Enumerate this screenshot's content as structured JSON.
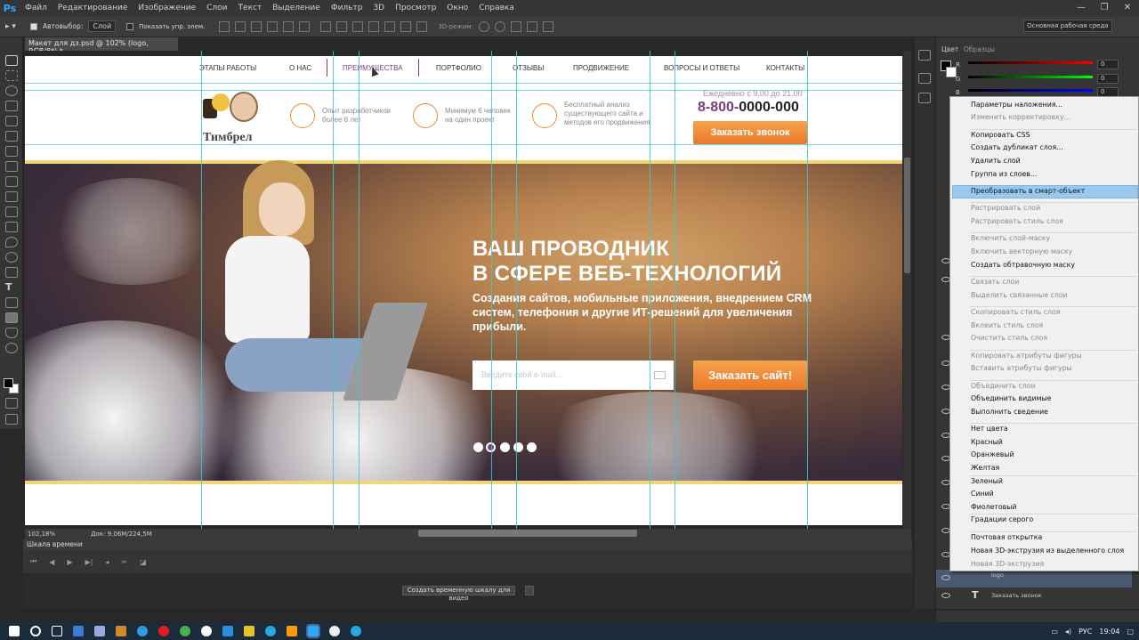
{
  "app": {
    "logo": "Ps",
    "menu": [
      "Файл",
      "Редактирование",
      "Изображение",
      "Слои",
      "Текст",
      "Выделение",
      "Фильтр",
      "3D",
      "Просмотр",
      "Окно",
      "Справка"
    ],
    "window_controls": [
      "—",
      "❐",
      "✕"
    ]
  },
  "options": {
    "tool": "▸ ▾",
    "autoselect_label": "Автовыбор:",
    "autoselect_value": "Слой",
    "show_controls_label": "Показать упр. элем.",
    "mode_3d": "3D-режим:",
    "workspace": "Основная рабочая среда"
  },
  "document": {
    "tab_title": "Макет для дз.psd @ 102% (logo, RGB/8*) *",
    "zoom": "102,18%",
    "doc_size": "Док: 9,06M/224,5M"
  },
  "site": {
    "nav": [
      "ЭТАПЫ РАБОТЫ",
      "О НАС",
      "ПРЕИМУЩЕСТВА",
      "ПОРТФОЛИО",
      "ОТЗЫВЫ",
      "ПРОДВИЖЕНИЕ",
      "ВОПРОСЫ И ОТВЕТЫ",
      "КОНТАКТЫ"
    ],
    "logo_text": "Тимбрел",
    "features": [
      {
        "line1": "Опыт разработчиков",
        "line2": "более 6 лет",
        "line3": ""
      },
      {
        "line1": "Минимум 6 человек",
        "line2": "на один проект",
        "line3": ""
      },
      {
        "line1": "Бесплатный анализ",
        "line2": "существующего сайта и",
        "line3": "методов его продвижения."
      }
    ],
    "hours": "Ежедневно с 9.00 до 21.00",
    "phone_prefix": "8-800-",
    "phone_rest": "0000-000",
    "callback_button": "Заказать звонок",
    "hero_title_1": "ВАШ ПРОВОДНИК",
    "hero_title_2": "В СФЕРЕ ВЕБ-ТЕХНОЛОГИЙ",
    "hero_sub_1": "Создания сайтов, мобильные приложения,  внедрением CRM",
    "hero_sub_2": "систем, телефония и другие ИТ-решений для увеличения",
    "hero_sub_3": "прибыли.",
    "email_placeholder": "Введите свой e-mail...",
    "order_button": "Заказать сайт!"
  },
  "timeline": {
    "title": "Шкала времени",
    "create_button": "Создать временную шкалу для видео"
  },
  "panels": {
    "tab_color": "Цвет",
    "tab_swatches": "Образцы",
    "r_label": "R",
    "g_label": "G",
    "b_label": "B",
    "r_value": "0",
    "g_value": "0",
    "b_value": "0",
    "layer_logo": "logo",
    "layer_callback": "Заказать звонок"
  },
  "context_menu": [
    {
      "label": "Параметры наложения...",
      "enabled": true
    },
    {
      "label": "Изменить корректировку...",
      "enabled": false
    },
    {
      "label": "Копировать CSS",
      "enabled": true
    },
    {
      "label": "Создать дубликат слоя...",
      "enabled": true
    },
    {
      "label": "Удалить слой",
      "enabled": true
    },
    {
      "label": "Группа из слоев...",
      "enabled": true
    },
    {
      "label": "Преобразовать в смарт-объект",
      "enabled": true
    },
    {
      "label": "Растрировать слой",
      "enabled": false
    },
    {
      "label": "Растрировать стиль слоя",
      "enabled": false
    },
    {
      "label": "Включить слой-маску",
      "enabled": false
    },
    {
      "label": "Включить векторную маску",
      "enabled": false
    },
    {
      "label": "Создать обтравочную маску",
      "enabled": true
    },
    {
      "label": "Связать слои",
      "enabled": false
    },
    {
      "label": "Выделить связанные слои",
      "enabled": false
    },
    {
      "label": "Скопировать стиль слоя",
      "enabled": false
    },
    {
      "label": "Вклеить стиль слоя",
      "enabled": false
    },
    {
      "label": "Очистить стиль слоя",
      "enabled": false
    },
    {
      "label": "Копировать атрибуты фигуры",
      "enabled": false
    },
    {
      "label": "Вставить атрибуты фигуры",
      "enabled": false
    },
    {
      "label": "Объединить слои",
      "enabled": false
    },
    {
      "label": "Объединить видимые",
      "enabled": true
    },
    {
      "label": "Выполнить сведение",
      "enabled": true
    },
    {
      "label": "Нет цвета",
      "enabled": true
    },
    {
      "label": "Красный",
      "enabled": true
    },
    {
      "label": "Оранжевый",
      "enabled": true
    },
    {
      "label": "Желтая",
      "enabled": true
    },
    {
      "label": "Зеленый",
      "enabled": true
    },
    {
      "label": "Синий",
      "enabled": true
    },
    {
      "label": "Фиолетовый",
      "enabled": true
    },
    {
      "label": "Градации серого",
      "enabled": true
    },
    {
      "label": "Почтовая открытка",
      "enabled": true
    },
    {
      "label": "Новая 3D-экструзия из выделенного слоя",
      "enabled": true
    },
    {
      "label": "Новая 3D-экструзия",
      "enabled": false
    }
  ],
  "taskbar": {
    "lang": "РУС",
    "time": "19:04"
  },
  "colors": {
    "accent_purple": "#7b3d82",
    "accent_orange": "#e8782a",
    "guide_cyan": "#37c9d6",
    "menu_highlight": "#99c9ef"
  }
}
